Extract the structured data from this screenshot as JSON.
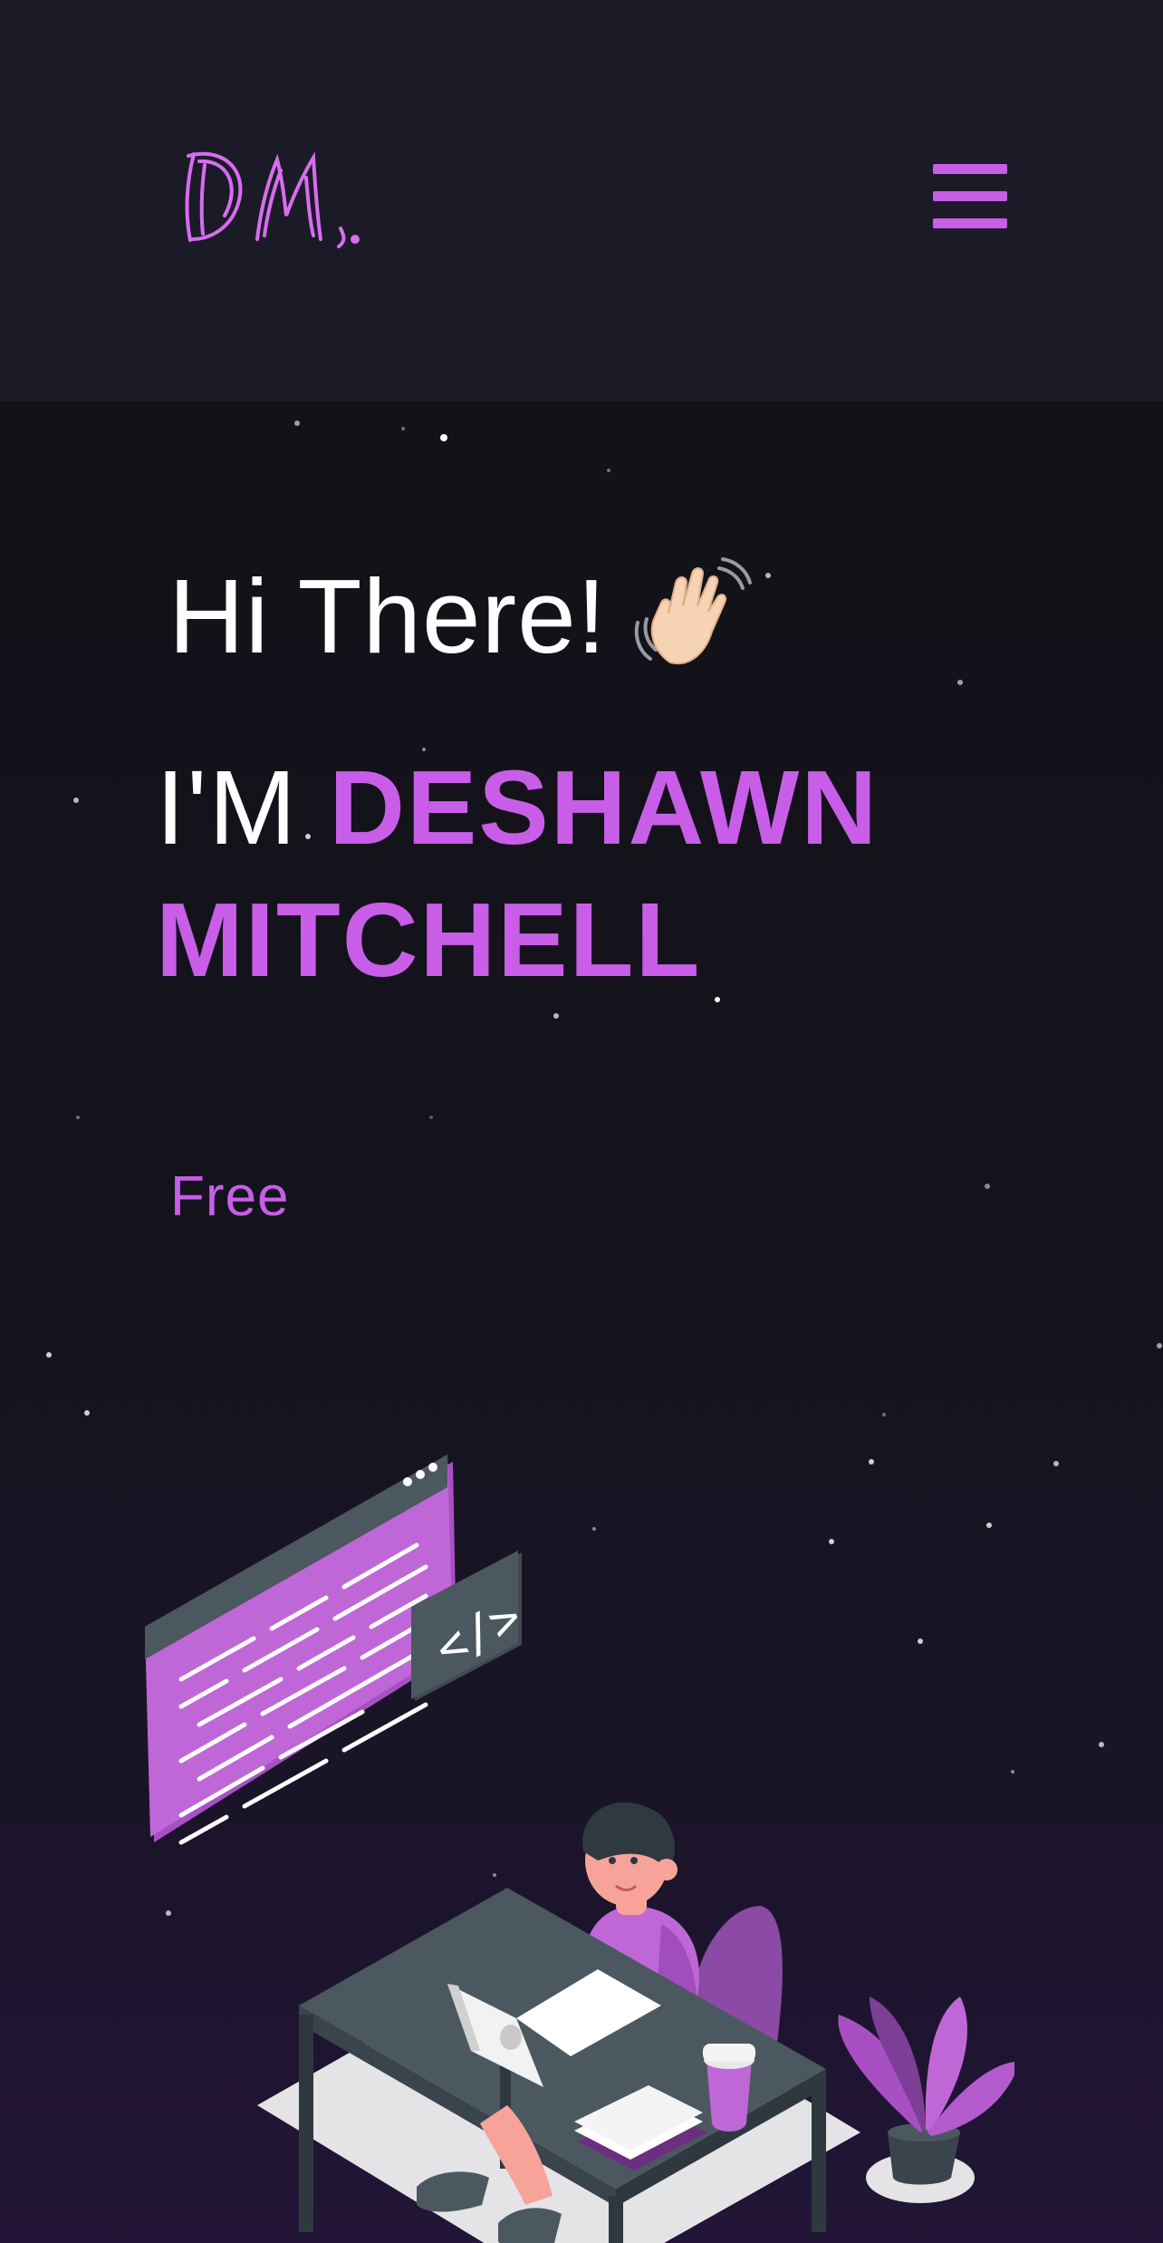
{
  "header": {
    "logo_text": "DM.",
    "menu_icon": "hamburger-menu-icon",
    "accent_color": "#c85ee8"
  },
  "hero": {
    "greeting": "Hi There!",
    "wave_icon": "waving-hand-icon",
    "intro_prefix": "I'M",
    "name": "DESHAWN MITCHELL",
    "role_text": "Free",
    "illustration": "developer-at-desk-illustration"
  },
  "colors": {
    "background": "#15141f",
    "nav_background": "#1b1b27",
    "accent": "#c85ee8",
    "text": "#ffffff"
  }
}
